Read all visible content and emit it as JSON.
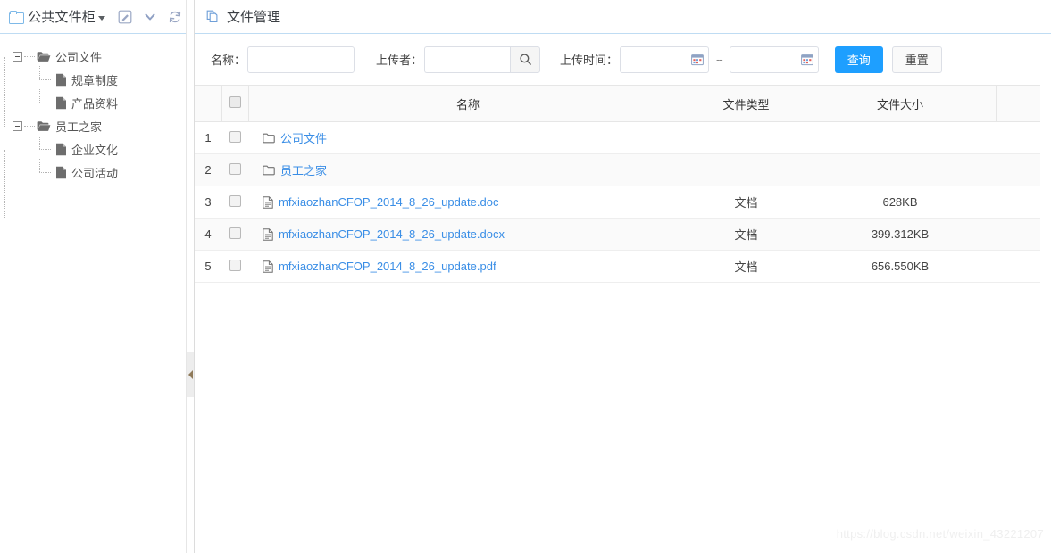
{
  "left_panel": {
    "header": {
      "folder_icon": "folder-outline-icon",
      "title": "公共文件柜",
      "caret": "caret-down-icon",
      "actions": [
        {
          "name": "edit-icon",
          "label": "编辑"
        },
        {
          "name": "chevron-down-icon",
          "label": "展开"
        },
        {
          "name": "refresh-icon",
          "label": "刷新"
        }
      ]
    },
    "tree": [
      {
        "label": "公司文件",
        "level": 1,
        "icon": "folder-open-icon",
        "expanded": true
      },
      {
        "label": "规章制度",
        "level": 2,
        "icon": "file-icon"
      },
      {
        "label": "产品资料",
        "level": 2,
        "icon": "file-icon"
      },
      {
        "label": "员工之家",
        "level": 1,
        "icon": "folder-open-icon",
        "expanded": true
      },
      {
        "label": "企业文化",
        "level": 2,
        "icon": "file-icon"
      },
      {
        "label": "公司活动",
        "level": 2,
        "icon": "file-icon"
      }
    ],
    "splitter": {
      "name": "panel-splitter",
      "arrow": "triangle-left-icon"
    }
  },
  "right_panel": {
    "header": {
      "icon": "copy-document-icon",
      "title": "文件管理"
    },
    "search": {
      "name_label": "名称：",
      "name_value": "",
      "name_placeholder": "",
      "uploader_label": "上传者：",
      "uploader_value": "",
      "uploader_placeholder": "",
      "uploader_search_icon": "search-icon",
      "upload_time_label": "上传时间：",
      "date_start_value": "",
      "date_start_placeholder": "",
      "date_end_value": "",
      "date_end_placeholder": "",
      "date_icon": "calendar-icon",
      "range_separator": "--",
      "query_button": "查询",
      "reset_button": "重置",
      "query_button_color": "#1E9FFF"
    },
    "table": {
      "columns": [
        "",
        "",
        "名称",
        "文件类型",
        "文件大小",
        ""
      ],
      "header_checkbox": "select-all-checkbox",
      "rows": [
        {
          "index": "1",
          "name": "公司文件",
          "icon": "folder-icon",
          "type": "",
          "size": ""
        },
        {
          "index": "2",
          "name": "员工之家",
          "icon": "folder-icon",
          "type": "",
          "size": ""
        },
        {
          "index": "3",
          "name": "mfxiaozhanCFOP_2014_8_26_update.doc",
          "icon": "file-icon",
          "type": "文档",
          "size": "628KB"
        },
        {
          "index": "4",
          "name": "mfxiaozhanCFOP_2014_8_26_update.docx",
          "icon": "file-icon",
          "type": "文档",
          "size": "399.312KB"
        },
        {
          "index": "5",
          "name": "mfxiaozhanCFOP_2014_8_26_update.pdf",
          "icon": "file-icon",
          "type": "文档",
          "size": "656.550KB"
        }
      ]
    }
  },
  "watermark": "https://blog.csdn.net/weixin_43221207"
}
